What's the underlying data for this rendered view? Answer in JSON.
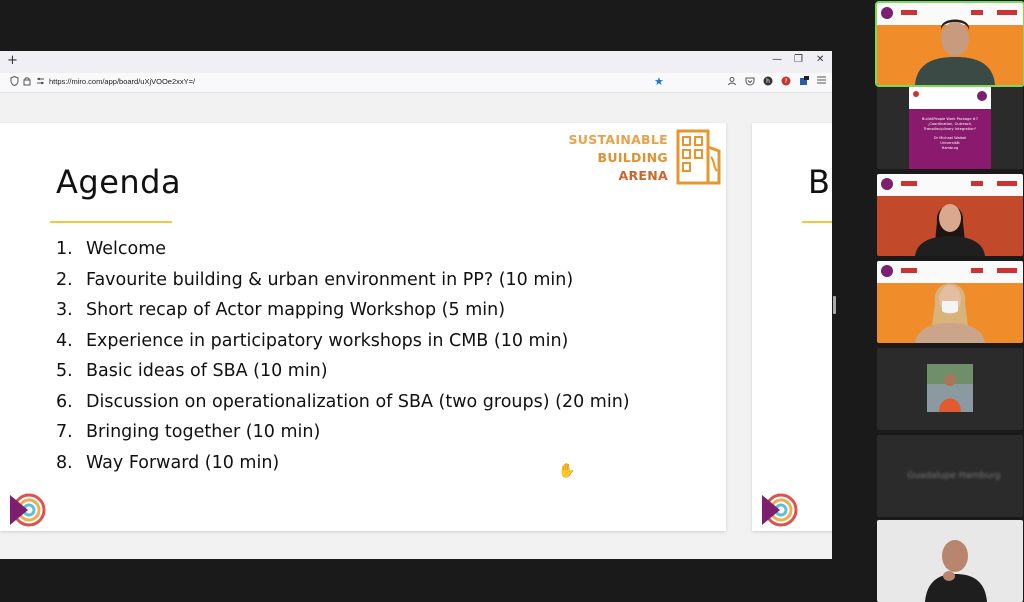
{
  "browser": {
    "new_tab_label": "+",
    "url": "https://miro.com/app/board/uXjVOOe2xxY=/",
    "window_controls": {
      "minimize": "—",
      "maximize": "❐",
      "close": "✕"
    }
  },
  "slide": {
    "title": "Agenda",
    "logo_text": [
      "SUSTAINABLE",
      "BUILDING",
      "ARENA"
    ],
    "items": [
      {
        "num": "1.",
        "text": "Welcome"
      },
      {
        "num": "2.",
        "text": "Favourite building & urban environment in PP?  (10 min)"
      },
      {
        "num": "3.",
        "text": "Short recap of Actor mapping Workshop (5 min)"
      },
      {
        "num": "4.",
        "text": "Experience in participatory workshops in CMB (10 min)"
      },
      {
        "num": "5.",
        "text": "Basic ideas of SBA (10 min)"
      },
      {
        "num": "6.",
        "text": "Discussion on operationalization of SBA (two groups) (20 min)"
      },
      {
        "num": "7.",
        "text": "Bringing together (10 min)"
      },
      {
        "num": "8.",
        "text": "Way Forward (10 min)"
      }
    ]
  },
  "next_slide": {
    "title_partial": "B"
  },
  "participants": {
    "shared_slide_lines": [
      "Build4People Work Package #7",
      "„Coordination, Outreach,",
      "Transdisciplinary Integration\"",
      "",
      "Dr Michael Waibel",
      "Universität",
      "Hamburg"
    ],
    "blurred_name": "Guadalupe Hamburg"
  },
  "colors": {
    "accent_yellow": "#f2c744",
    "logo_orange": "#e09231",
    "active_speaker": "#7ed957"
  }
}
